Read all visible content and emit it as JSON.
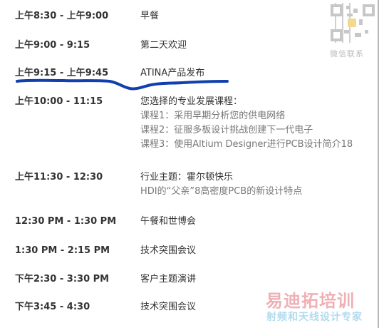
{
  "qr": {
    "caption": "微信联系"
  },
  "watermark": {
    "main": "易迪拓培训",
    "sub": "射频和天线设计专家"
  },
  "highlight": {
    "color": "#123fae"
  },
  "schedule": [
    {
      "time": "上午8:30 - 上午9:00",
      "title": "早餐",
      "subitems": []
    },
    {
      "time": "上午9:00 - 9:15",
      "title": "第二天欢迎",
      "subitems": []
    },
    {
      "time": "上午9:15 - 上午9:45",
      "title": "ATINA产品发布",
      "subitems": []
    },
    {
      "time": "上午10:00 - 11:15",
      "title": "您选择的专业发展课程：",
      "subitems": [
        "课程1：采用早期分析您的供电网络",
        "课程2：征服多板设计挑战创建下一代电子",
        "课程3：使用Altium Designer进行PCB设计简介18"
      ]
    },
    {
      "time": "上午11:30 - 12:30",
      "title": "行业主题：霍尔顿快乐",
      "subitems": [
        "HDI的“父亲”8高密度PCB的新设计特点"
      ]
    },
    {
      "time": "12:30 PM - 1:30 PM",
      "title": "午餐和世博会",
      "subitems": []
    },
    {
      "time": "1:30 PM - 2:15 PM",
      "title": "技术突围会议",
      "subitems": []
    },
    {
      "time": "下午2:30 - 3:30 PM",
      "title": "客户主题演讲",
      "subitems": []
    },
    {
      "time": "下午3:45 - 4:30",
      "title": "技术突围会议",
      "subitems": []
    }
  ]
}
